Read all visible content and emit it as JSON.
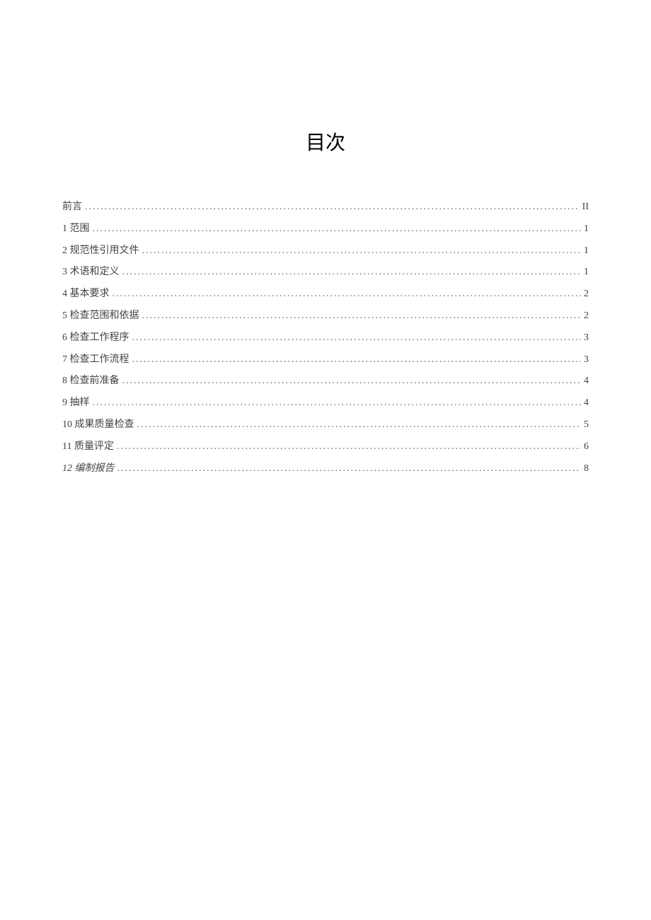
{
  "title": "目次",
  "toc": [
    {
      "label": "前言",
      "page": "II",
      "italic": false
    },
    {
      "label": "1 范围",
      "page": "1",
      "italic": false
    },
    {
      "label": "2 规范性引用文件",
      "page": "1",
      "italic": false
    },
    {
      "label": "3 术语和定义",
      "page": "1",
      "italic": false
    },
    {
      "label": "4 基本要求",
      "page": "2",
      "italic": false
    },
    {
      "label": "5 检查范围和依据",
      "page": "2",
      "italic": false
    },
    {
      "label": "6 检查工作程序",
      "page": "3",
      "italic": false
    },
    {
      "label": "7 检查工作流程",
      "page": "3",
      "italic": false
    },
    {
      "label": "8 检查前准备",
      "page": "4",
      "italic": false
    },
    {
      "label": "9 抽样",
      "page": "4",
      "italic": false
    },
    {
      "label": "10 成果质量检查",
      "page": "5",
      "italic": false
    },
    {
      "label": "11 质量评定",
      "page": "6",
      "italic": false
    },
    {
      "label": "12 编制报告",
      "page": "8",
      "italic": true
    }
  ]
}
